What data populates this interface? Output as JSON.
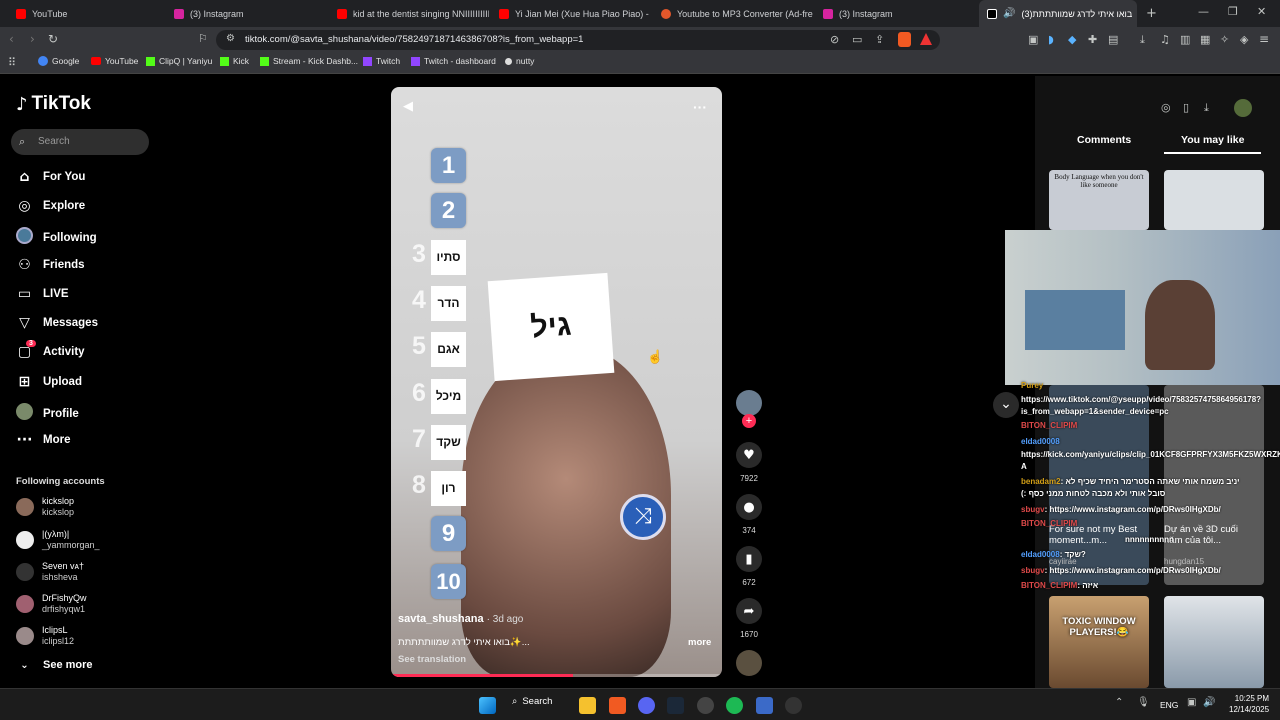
{
  "tabs": [
    {
      "title": "YouTube",
      "color": "#ff0000"
    },
    {
      "title": "(3) Instagram",
      "color": "#d6249f"
    },
    {
      "title": "kid at the dentist singing NNIIIIIIIIIII",
      "color": "#ff0000"
    },
    {
      "title": "Yi Jian Mei (Xue Hua Piao Piao) - Do",
      "color": "#ff0000"
    },
    {
      "title": "Youtube to MP3 Converter (Ad-free)",
      "color": "#e2572b"
    },
    {
      "title": "(3) Instagram",
      "color": "#d6249f"
    },
    {
      "title": "בואו איתי לדרג שמוותתתת(3)",
      "color": "#ffffff"
    }
  ],
  "url": "tiktok.com/@savta_shushana/video/7582497187146386708?is_from_webapp=1",
  "bookmarks": [
    "Google",
    "YouTube",
    "ClipQ | Yaniyu",
    "Kick",
    "Stream - Kick Dashb...",
    "Twitch",
    "Twitch - dashboard",
    "nutty"
  ],
  "brand": "TikTok",
  "search_placeholder": "Search",
  "nav": [
    {
      "label": "For You",
      "icon": "home-icon"
    },
    {
      "label": "Explore",
      "icon": "compass-icon"
    },
    {
      "label": "Following",
      "icon": "following-avatar-icon"
    },
    {
      "label": "Friends",
      "icon": "friends-icon"
    },
    {
      "label": "LIVE",
      "icon": "live-icon"
    },
    {
      "label": "Messages",
      "icon": "messages-icon"
    },
    {
      "label": "Activity",
      "icon": "activity-icon",
      "badge": "3"
    },
    {
      "label": "Upload",
      "icon": "upload-icon"
    },
    {
      "label": "Profile",
      "icon": "profile-avatar-icon"
    },
    {
      "label": "More",
      "icon": "more-icon"
    }
  ],
  "following_title": "Following accounts",
  "accounts": [
    {
      "name": "kickslop",
      "handle": "kickslop"
    },
    {
      "name": "|(yλm)|",
      "handle": "_yammorgan_"
    },
    {
      "name": "Seven ᴠᴀ†",
      "handle": "ishsheva"
    },
    {
      "name": "DrFishyQw",
      "handle": "drfishyqw1"
    },
    {
      "name": "IclipsL",
      "handle": "iclipsl12"
    }
  ],
  "see_more": "See more",
  "video": {
    "author": "savta_shushana",
    "age": "· 3d ago",
    "caption": "בואו איתי לדרג שמוותתתתת✨...",
    "more": "more",
    "see_translation": "See translation",
    "card_text": "גיל",
    "rank_numbers": [
      "1",
      "2",
      "3",
      "4",
      "5",
      "6",
      "7",
      "8",
      "9",
      "10"
    ],
    "rank_names": {
      "3": "סתיו",
      "4": "הדר",
      "5": "אגם",
      "6": "מיכל",
      "7": "שקד",
      "8": "רון"
    },
    "progress": 0.55
  },
  "actions": {
    "likes": "7922",
    "comments": "374",
    "saves": "672",
    "shares": "1670"
  },
  "panel_tabs": {
    "comments": "Comments",
    "you_may_like": "You may like"
  },
  "thumbs": {
    "t1_text": "Body Language when you don't like someone",
    "t3_text": "TOXIC WINDOW PLAYERS!😂",
    "t_caption_left": "For sure not my Best moment...m...",
    "t_caption_left_user": "cayiirae",
    "t_caption_right": "Dự án về 3D cuối năm của tôi...",
    "t_caption_right_user": "hungdan15"
  },
  "chat": [
    {
      "user": "Purey",
      "msg": ""
    },
    {
      "user": "",
      "msg": "https://www.tiktok.com/@yseupp/video/7583257475864956178?"
    },
    {
      "user": "",
      "msg": "is_from_webapp=1&sender_device=pc"
    },
    {
      "user": "BITON_CLIPIM",
      "msg": ""
    },
    {
      "user": "eldad0008",
      "msg": ""
    },
    {
      "user": "",
      "msg": "https://kick.com/yaniyu/clips/clip_01KCF8GFPRFYX3M5FKZ5WXRZK"
    },
    {
      "user": "",
      "msg": "A"
    },
    {
      "user": "benadam2",
      "msg": ": יניב משמח אותי שאתה הסטרימר היחיד שכיף לא"
    },
    {
      "user": "",
      "msg": "(: סובל אותי ולא מכבה לטחות ממני כסף"
    },
    {
      "user": "sbugv",
      "msg": ": https://www.instagram.com/p/DRws0lHgXDb/"
    },
    {
      "user": "BITON_CLIPIM",
      "msg": ""
    },
    {
      "user": "",
      "msg": "nnnnnnnnnn"
    },
    {
      "user": "eldad0008",
      "msg": ": שקד?"
    },
    {
      "user": "sbugv",
      "msg": ": https://www.instagram.com/p/DRws0lHgXDb/"
    },
    {
      "user": "BITON_CLIPIM",
      "msg": ": איזה"
    }
  ],
  "taskbar": {
    "search": "Search",
    "lang": "ENG",
    "time": "10:25 PM",
    "date": "12/14/2025"
  },
  "colors": {
    "tiktok_red": "#fe2c55",
    "rank_blue": "#7d9cc4"
  }
}
